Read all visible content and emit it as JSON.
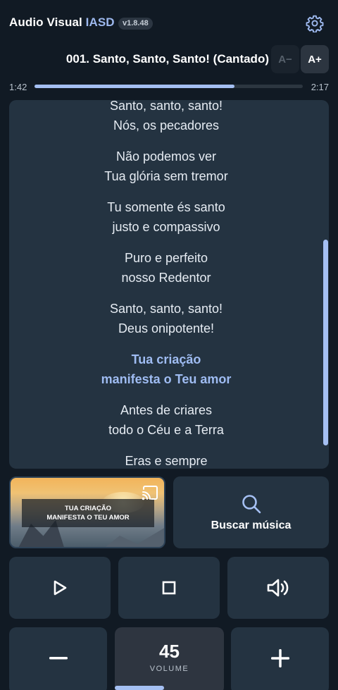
{
  "app": {
    "title": "Audio Visual ",
    "title_accent": "IASD",
    "version": "v1.8.48"
  },
  "song": {
    "title": "001. Santo, Santo, Santo! (Cantado)"
  },
  "font_controls": {
    "decrease": "A−",
    "increase": "A+"
  },
  "playback": {
    "current_time": "1:42",
    "total_time": "2:17",
    "progress": 0.745
  },
  "lyrics": {
    "stanzas": [
      {
        "lines": [
          "Santo, santo, santo!",
          "Nós, os pecadores"
        ],
        "active": false
      },
      {
        "lines": [
          "Não podemos ver",
          "Tua glória sem tremor"
        ],
        "active": false
      },
      {
        "lines": [
          "Tu somente és santo",
          "justo e compassivo"
        ],
        "active": false
      },
      {
        "lines": [
          "Puro e perfeito",
          "nosso Redentor"
        ],
        "active": false
      },
      {
        "lines": [
          "Santo, santo, santo!",
          "Deus onipotente!"
        ],
        "active": false
      },
      {
        "lines": [
          "Tua criação",
          "manifesta o Teu amor"
        ],
        "active": true
      },
      {
        "lines": [
          "Antes de criares",
          "todo o Céu e a Terra"
        ],
        "active": false
      },
      {
        "lines": [
          "Eras e sempre",
          ""
        ],
        "active": false
      }
    ]
  },
  "preview": {
    "line1": "TUA CRIAÇÃO",
    "line2": "MANIFESTA O TEU AMOR",
    "icon": "cast-icon"
  },
  "search": {
    "label": "Buscar música",
    "icon": "search-icon"
  },
  "controls": {
    "play_icon": "play-icon",
    "stop_icon": "stop-icon",
    "volume_icon": "volume-icon"
  },
  "volume": {
    "value": "45",
    "caption": "VOLUME",
    "level": 0.45,
    "decrease_icon": "minus-icon",
    "increase_icon": "plus-icon"
  },
  "colors": {
    "background": "#111a24",
    "panel": "#243341",
    "accent": "#9fbcf2"
  }
}
